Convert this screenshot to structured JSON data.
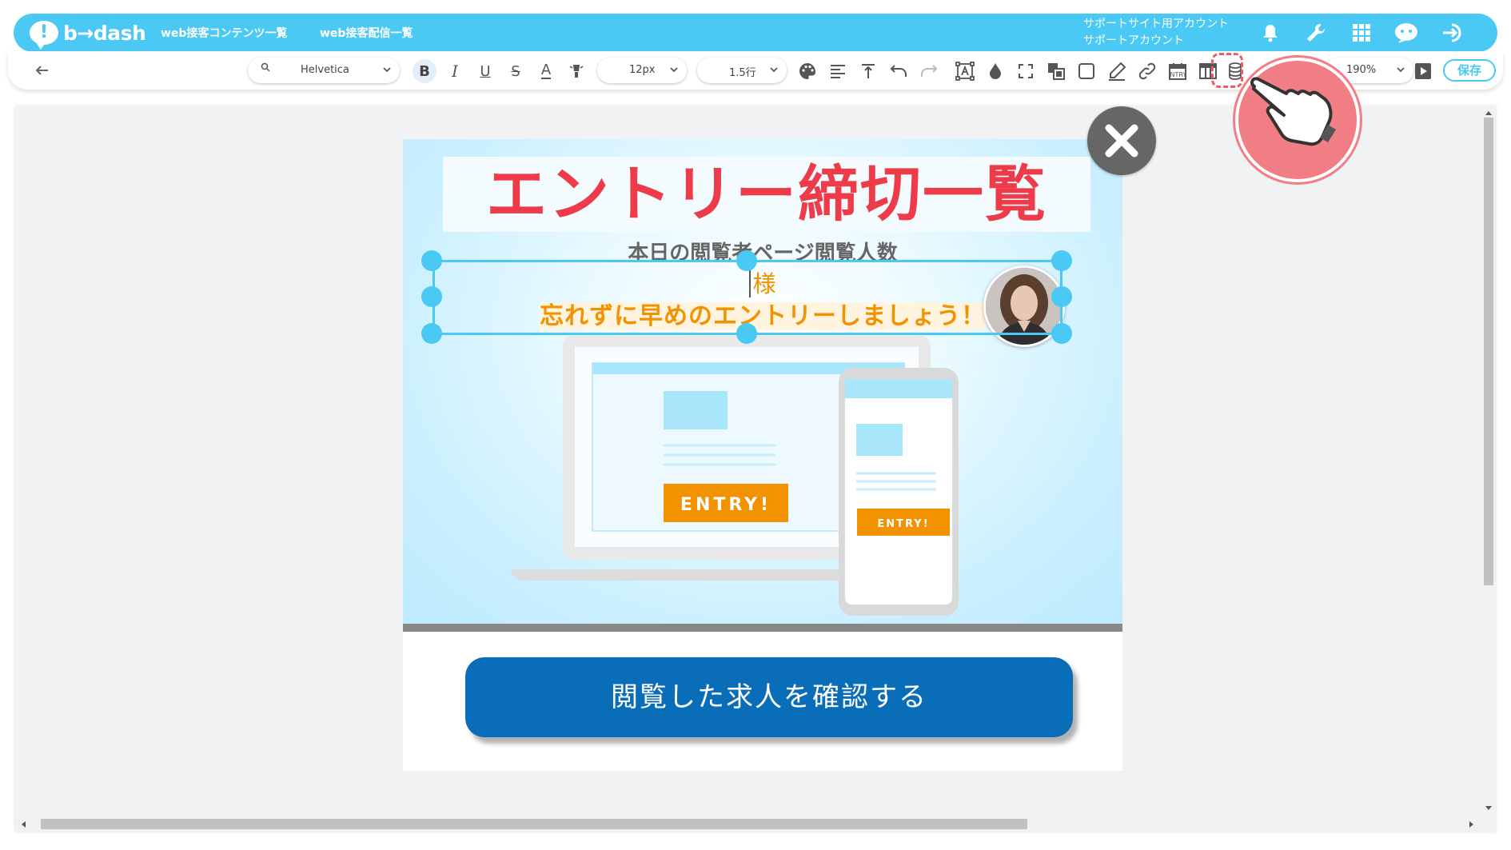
{
  "header": {
    "logo_text": "b→dash",
    "nav": [
      "web接客コンテンツ一覧",
      "web接客配信一覧"
    ],
    "account_line1": "サポートサイト用アカウント",
    "account_line2": "サポートアカウント"
  },
  "toolbar": {
    "font_family": "Helvetica",
    "font_size": "12px",
    "line_height": "1.5行",
    "zoom": "190%",
    "save_label": "保存"
  },
  "popup": {
    "title": "エントリー締切一覧",
    "subtitle": "本日の閲覧者ページ閲覧人数",
    "honorific": "様",
    "message": "忘れずに早めのエントリーしましょう！",
    "entry_label": "ENTRY!",
    "cta_label": "閲覧した求人を確認する"
  },
  "colors": {
    "brand": "#49c9f3",
    "title_red": "#ee3b4a",
    "message_orange": "#f39200",
    "cta_blue": "#0a6db8",
    "annotation_pink": "#f27e85"
  },
  "icons": [
    "bell-icon",
    "wrench-icon",
    "grid-icon",
    "chat-icon",
    "logout-icon",
    "search-icon",
    "bold-icon",
    "italic-icon",
    "underline-icon",
    "strike-icon",
    "font-color-icon",
    "highlight-icon",
    "palette-icon",
    "align-icon",
    "valign-icon",
    "undo-icon",
    "redo-icon",
    "resize-icon",
    "drop-icon",
    "fullscreen-icon",
    "layer-icon",
    "border-icon",
    "pen-icon",
    "link-icon",
    "calendar-icon",
    "table-icon",
    "database-icon",
    "preview-icon",
    "close-icon",
    "hand-pointer-icon"
  ]
}
